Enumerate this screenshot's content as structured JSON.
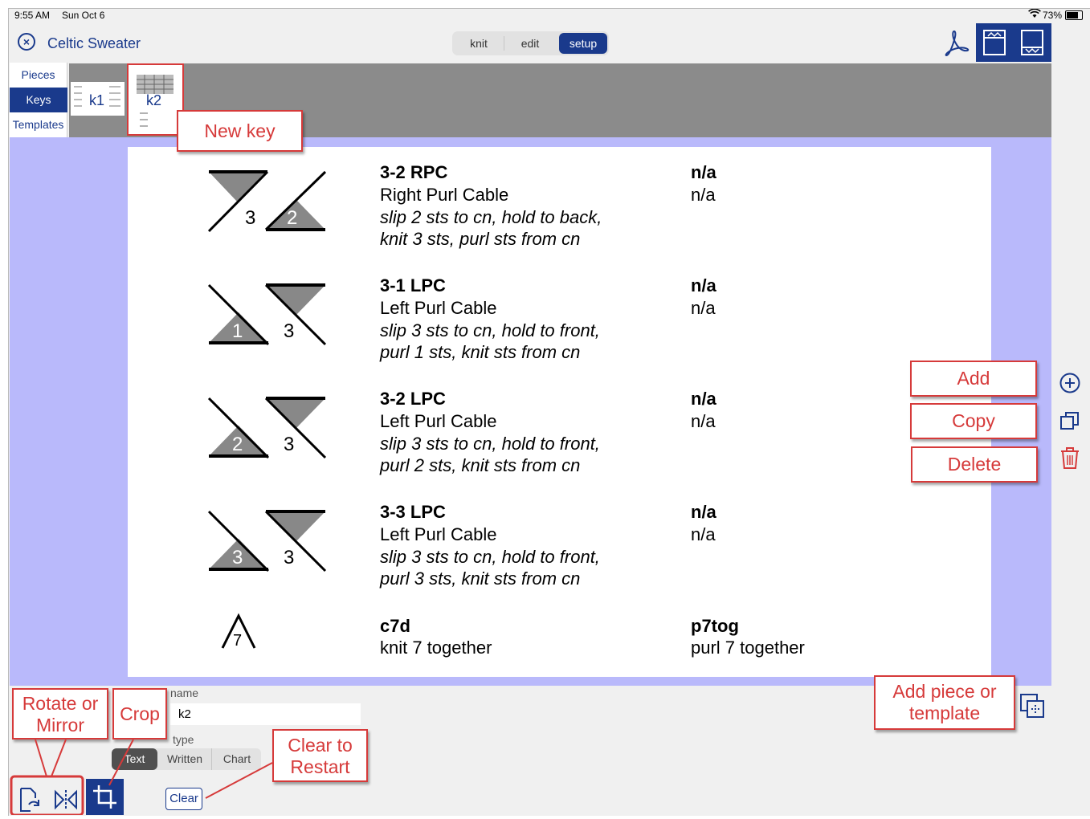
{
  "status_bar": {
    "time": "9:55 AM",
    "date": "Sun Oct 6",
    "battery": "73%"
  },
  "header": {
    "close_icon": "close-circle-icon",
    "title": "Celtic Sweater"
  },
  "mode_tabs": [
    {
      "label": "knit",
      "selected": false
    },
    {
      "label": "edit",
      "selected": false
    },
    {
      "label": "setup",
      "selected": true
    }
  ],
  "side_tabs": [
    {
      "label": "Pieces",
      "selected": false
    },
    {
      "label": "Keys",
      "selected": true
    },
    {
      "label": "Templates",
      "selected": false
    }
  ],
  "thumbnails": [
    {
      "label": "k1",
      "selected": false
    },
    {
      "label": "k2",
      "selected": true
    }
  ],
  "key_entries": [
    {
      "symbol_num_a": "3",
      "symbol_num_b": "2",
      "code": "3-2 RPC",
      "name": "Right Purl Cable",
      "desc1": "slip 2 sts to cn, hold to back,",
      "desc2": "knit 3 sts, purl sts from cn",
      "ws_code": "n/a",
      "ws_name": "n/a"
    },
    {
      "symbol_num_a": "1",
      "symbol_num_b": "3",
      "code": "3-1 LPC",
      "name": "Left Purl Cable",
      "desc1": "slip 3 sts to cn, hold to front,",
      "desc2": "purl 1 sts, knit sts from cn",
      "ws_code": "n/a",
      "ws_name": "n/a"
    },
    {
      "symbol_num_a": "2",
      "symbol_num_b": "3",
      "code": "3-2 LPC",
      "name": "Left Purl Cable",
      "desc1": "slip 3 sts to cn, hold to front,",
      "desc2": "purl 2 sts, knit sts from cn",
      "ws_code": "n/a",
      "ws_name": "n/a"
    },
    {
      "symbol_num_a": "3",
      "symbol_num_b": "3",
      "code": "3-3 LPC",
      "name": "Left Purl Cable",
      "desc1": "slip 3 sts to cn, hold to front,",
      "desc2": "purl 3 sts, knit sts from cn",
      "ws_code": "n/a",
      "ws_name": "n/a"
    }
  ],
  "last_entry": {
    "symbol_num": "7",
    "code": "c7d",
    "name": "knit 7 together",
    "ws_code": "p7tog",
    "ws_name": "purl 7 together"
  },
  "bottom": {
    "name_label": "name",
    "name_value": "k2",
    "type_label": "type",
    "type_options": [
      {
        "label": "Text",
        "selected": true
      },
      {
        "label": "Written",
        "selected": false
      },
      {
        "label": "Chart",
        "selected": false
      }
    ],
    "clear_label": "Clear"
  },
  "callouts": {
    "new_key": "New key",
    "add": "Add",
    "copy": "Copy",
    "delete": "Delete",
    "add_piece": "Add piece or template",
    "rotate": "Rotate or Mirror",
    "crop": "Crop",
    "clear": "Clear to Restart"
  },
  "colors": {
    "accent": "#1a3a8c",
    "callout_red": "#d63a3a",
    "band": "#b9b9fb",
    "strip_gray": "#8b8b8b"
  }
}
